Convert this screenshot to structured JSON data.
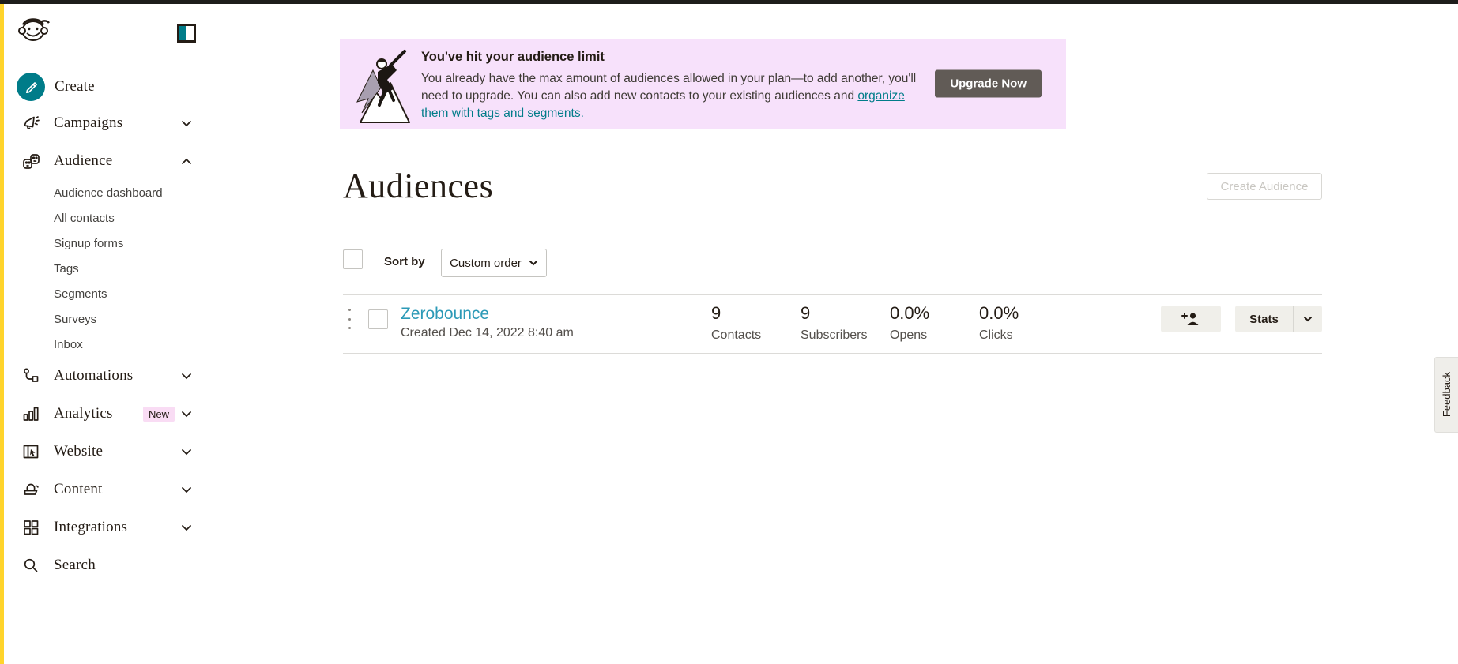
{
  "colors": {
    "brand_yellow": "#ffd42b",
    "teal": "#007c89",
    "link_teal": "#2c9ab7",
    "banner_pink": "#f7e1fb",
    "text_dark": "#241c15",
    "upgrade_button_bg": "#615b56",
    "action_button_bg": "#f0efea",
    "new_badge_bg": "#f9dcf4"
  },
  "sidebar": {
    "items": [
      {
        "label": "Create"
      },
      {
        "label": "Campaigns"
      },
      {
        "label": "Audience"
      },
      {
        "label": "Automations"
      },
      {
        "label": "Analytics",
        "badge": "New"
      },
      {
        "label": "Website"
      },
      {
        "label": "Content"
      },
      {
        "label": "Integrations"
      },
      {
        "label": "Search"
      }
    ],
    "audience_subitems": [
      "Audience dashboard",
      "All contacts",
      "Signup forms",
      "Tags",
      "Segments",
      "Surveys",
      "Inbox"
    ]
  },
  "banner": {
    "title": "You've hit your audience limit",
    "body_text": "You already have the max amount of audiences allowed in your plan—to add another, you'll need to upgrade. You can also add new contacts to your existing audiences and ",
    "link_text": "organize them with tags and segments.",
    "button_label": "Upgrade Now"
  },
  "page": {
    "title": "Audiences",
    "create_audience_label": "Create Audience"
  },
  "toolbar": {
    "sort_label": "Sort by",
    "sort_value": "Custom order"
  },
  "audience_row": {
    "name": "Zerobounce",
    "created": "Created Dec 14, 2022 8:40 am",
    "stats": [
      {
        "value": "9",
        "label": "Contacts"
      },
      {
        "value": "9",
        "label": "Subscribers"
      },
      {
        "value": "0.0%",
        "label": "Opens"
      },
      {
        "value": "0.0%",
        "label": "Clicks"
      }
    ],
    "stats_button_label": "Stats"
  },
  "feedback_tab": {
    "label": "Feedback"
  }
}
